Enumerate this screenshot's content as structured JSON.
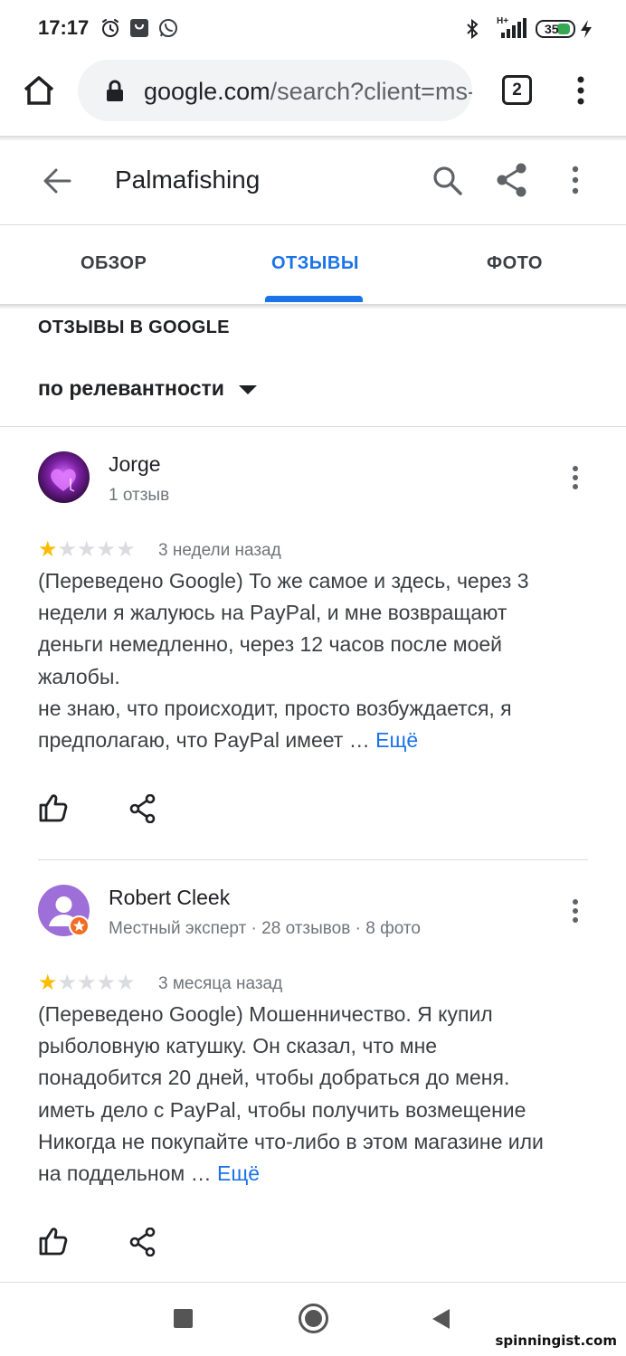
{
  "status_bar": {
    "time": "17:17",
    "network": "H+",
    "battery": "35",
    "icons": [
      "alarm-icon",
      "shopping-bag-icon",
      "whatsapp-icon",
      "bluetooth-icon",
      "signal-icon",
      "battery-icon",
      "charging-icon"
    ]
  },
  "browser": {
    "url_host": "google.com",
    "url_path": "/search?client=ms-android-xiaomi",
    "tab_count": "2",
    "icons": [
      "home-icon",
      "lock-icon",
      "overflow-menu-icon"
    ]
  },
  "place": {
    "title": "Palmafishing",
    "icons": [
      "back-arrow-icon",
      "search-icon",
      "share-icon",
      "overflow-menu-icon"
    ]
  },
  "tabs": [
    {
      "label": "ОБЗОР",
      "active": false
    },
    {
      "label": "ОТЗЫВЫ",
      "active": true
    },
    {
      "label": "ФОТО",
      "active": false
    }
  ],
  "reviews_section": {
    "title": "ОТЗЫВЫ В GOOGLE",
    "sort_label": "по релевантности"
  },
  "reviews": [
    {
      "author": "Jorge",
      "meta": "1 отзыв",
      "rating": 1,
      "max_rating": 5,
      "date": "3 недели назад",
      "text": "(Переведено Google) То же самое и здесь, через 3 недели я жалуюсь на PayPal, и мне возвращают деньги немедленно, через 12 часов после моей жалобы.\nне знаю, что происходит, просто возбуждается, я предполагаю, что PayPal имеет …",
      "more_label": "Ещё"
    },
    {
      "author": "Robert Cleek",
      "meta": "Местный эксперт · 28 отзывов · 8 фото",
      "rating": 1,
      "max_rating": 5,
      "date": "3 месяца назад",
      "text": "(Переведено Google) Мошенничество. Я купил рыболовную катушку. Он сказал, что мне понадобится 20 дней, чтобы добраться до меня. иметь дело с PayPal, чтобы получить возмещение Никогда не покупайте что-либо в этом магазине или на поддельном …",
      "more_label": "Ещё"
    }
  ],
  "colors": {
    "accent": "#1a73e8",
    "star_filled": "#fbbc04",
    "star_empty": "#dadce0",
    "text_primary": "#202124",
    "text_secondary": "#70757a"
  },
  "watermark": "spinningist.com"
}
